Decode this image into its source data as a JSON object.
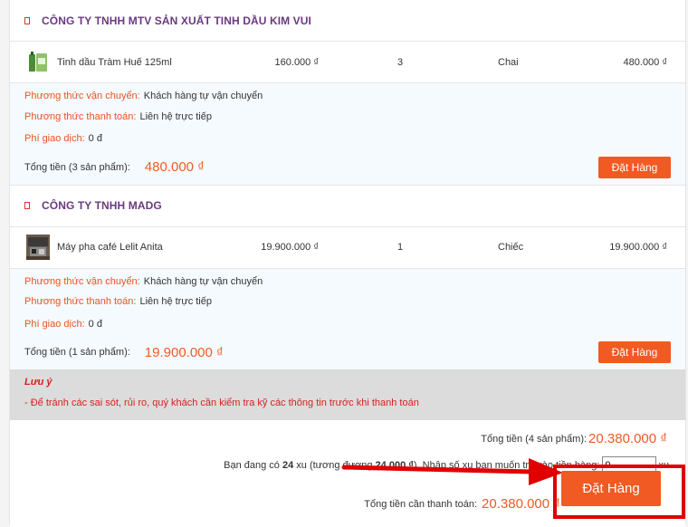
{
  "shops": [
    {
      "name": "CÔNG TY TNHH MTV SẢN XUẤT TINH DẦU KIM VUI",
      "product": {
        "name": "Tinh dầu Tràm Huế 125ml",
        "price": "160.000 ₫",
        "qty": "3",
        "unit": "Chai",
        "total": "480.000 ₫"
      },
      "shipping_label": "Phương thức vận chuyển:",
      "shipping_value": "Khách hàng tự vận chuyển",
      "payment_label": "Phương thức thanh toán:",
      "payment_value": "Liên hệ trực tiếp",
      "fee_label": "Phí giao dịch:",
      "fee_value": "0 đ",
      "sum_label": "Tổng tiền (3 sản phẩm):",
      "sum_value": "480.000 ₫",
      "order_button": "Đặt Hàng"
    },
    {
      "name": "CÔNG TY TNHH MADG",
      "product": {
        "name": "Máy pha café Lelit Anita",
        "price": "19.900.000 ₫",
        "qty": "1",
        "unit": "Chiếc",
        "total": "19.900.000 ₫"
      },
      "shipping_label": "Phương thức vận chuyển:",
      "shipping_value": "Khách hàng tự vận chuyển",
      "payment_label": "Phương thức thanh toán:",
      "payment_value": "Liên hệ trực tiếp",
      "fee_label": "Phí giao dịch:",
      "fee_value": "0 đ",
      "sum_label": "Tổng tiền (1 sản phẩm):",
      "sum_value": "19.900.000 ₫",
      "order_button": "Đặt Hàng"
    }
  ],
  "note": {
    "title": "Lưu ý",
    "text": "- Để tránh các sai sót, rủi ro, quý khách cần kiểm tra kỹ các thông tin trước khi thanh toán"
  },
  "footer": {
    "total_label": "Tổng tiền (4 sản phẩm):",
    "total_value": "20.380.000 ₫",
    "xu_prefix": "Bạn đang có",
    "xu_count": "24",
    "xu_mid": "xu (tương đương",
    "xu_equiv": "24.000 ₫",
    "xu_suffix": "). Nhập số xu bạn muốn trả vào tiền hàng:",
    "xu_input_value": "0",
    "xu_unit": "xu",
    "pay_label": "Tổng tiền cần thanh toán:",
    "pay_value": "20.380.000 ₫",
    "order_button": "Đặt Hàng"
  },
  "colors": {
    "accent": "#f15a22",
    "shop_title": "#6a3a7f",
    "highlight": "#e00000",
    "note_bg": "#dcdcdc"
  }
}
